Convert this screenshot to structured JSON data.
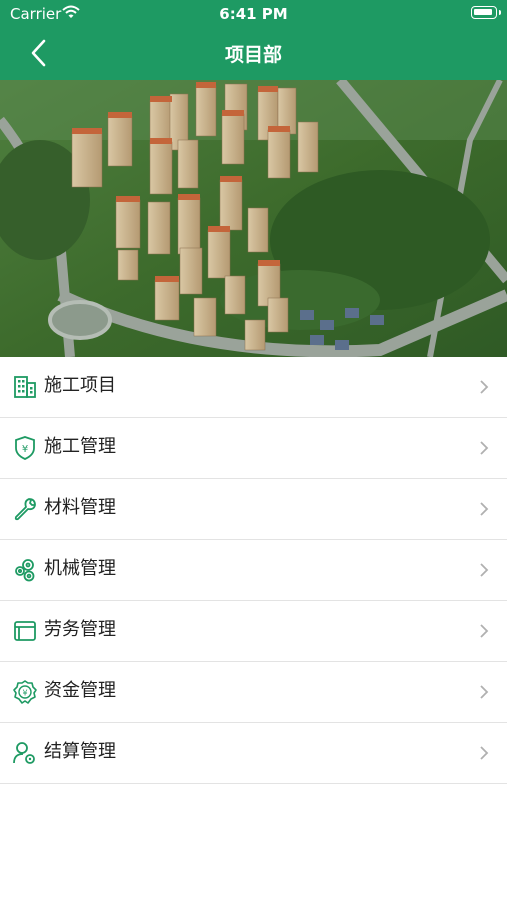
{
  "status": {
    "carrier": "Carrier",
    "time": "6:41 PM"
  },
  "nav": {
    "title": "项目部"
  },
  "banner": {
    "slide_count": 4,
    "active_slide": 1
  },
  "menu": [
    {
      "label": "施工项目",
      "icon": "building-icon"
    },
    {
      "label": "施工管理",
      "icon": "shield-yen-icon"
    },
    {
      "label": "材料管理",
      "icon": "wrench-icon"
    },
    {
      "label": "机械管理",
      "icon": "gears-icon"
    },
    {
      "label": "劳务管理",
      "icon": "card-icon"
    },
    {
      "label": "资金管理",
      "icon": "money-gear-icon"
    },
    {
      "label": "结算管理",
      "icon": "user-gear-icon"
    }
  ],
  "colors": {
    "brand": "#1e9a63",
    "icon": "#1e9a63",
    "chevron": "#b0b0b0"
  }
}
